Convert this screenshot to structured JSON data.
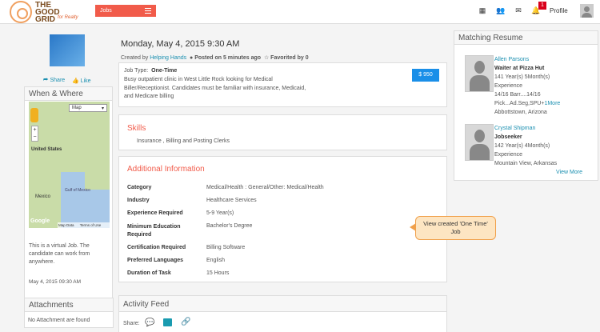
{
  "brand": {
    "line1": "THE",
    "line2": "GOOD",
    "line3": "GRID",
    "sub": "for Realty"
  },
  "topnav": {
    "jobs_label": "Jobs",
    "notif_count": "1",
    "profile_label": "Profile"
  },
  "sidebar": {
    "share_label": "Share",
    "like_label": "Like",
    "when_where_title": "When & Where",
    "map_type": "Map",
    "map_labels": [
      "United States",
      "Gulf of Mexico",
      "Mexico"
    ],
    "map_footer": "Map Data",
    "map_terms": "Terms of Use",
    "map_brand": "Google",
    "virtual_text": "This is a virtual Job. The candidate can work from anywhere.",
    "posted_at": "May 4, 2015 09:30 AM",
    "attachments_title": "Attachments",
    "attachments_empty": "No Attachment are found"
  },
  "job": {
    "title": "Monday, May 4, 2015 9:30 AM",
    "created_by_prefix": "Created by",
    "created_by": "Helping Hands",
    "posted_on": "Posted on 5 minutes ago",
    "favorited": "Favorited by 0",
    "job_type_label": "Job Type:",
    "job_type": "One-Time",
    "description": "Busy outpatient clinic in West Little Rock looking for Medical Biller/Receptionist. Candidates must be familiar with insurance, Medicaid, and Medicare billing",
    "price": "$ 950",
    "skills_title": "Skills",
    "skills": "Insurance ,  Billing and Posting Clerks",
    "additional_title": "Additional Information",
    "info": [
      {
        "label": "Category",
        "value": "Medical/Health :  General/Other: Medical/Health"
      },
      {
        "label": "Industry",
        "value": "Healthcare Services"
      },
      {
        "label": "Experience Required",
        "value": "5-9  Year(s)"
      },
      {
        "label": "Minimum Education Required",
        "value": "Bachelor's Degree"
      },
      {
        "label": "Certification Required",
        "value": "Billing Software"
      },
      {
        "label": "Preferred Languages",
        "value": "English"
      },
      {
        "label": "Duration of Task",
        "value": "15 Hours"
      }
    ],
    "activity_title": "Activity Feed",
    "share_prefix": "Share:"
  },
  "tooltip": "View created 'One Time' Job",
  "matching": {
    "title": "Matching Resume",
    "items": [
      {
        "name": "Allen Parsons",
        "role": "Waiter at Pizza Hut",
        "exp": "141 Year(s) 5Month(s)",
        "exp_label": "Experience",
        "extra1": "14/16 Barr....14/16",
        "extra2": "Pick...Ad.Seg,SPU+",
        "more": "1More",
        "location": "Abbottstown, Arizona"
      },
      {
        "name": "Crystal Shipman",
        "role": "Jobseeker",
        "exp": "142 Year(s) 4Month(s)",
        "exp_label": "Experience",
        "location": "Mountain View, Arkansas"
      }
    ],
    "view_more": "View More"
  }
}
